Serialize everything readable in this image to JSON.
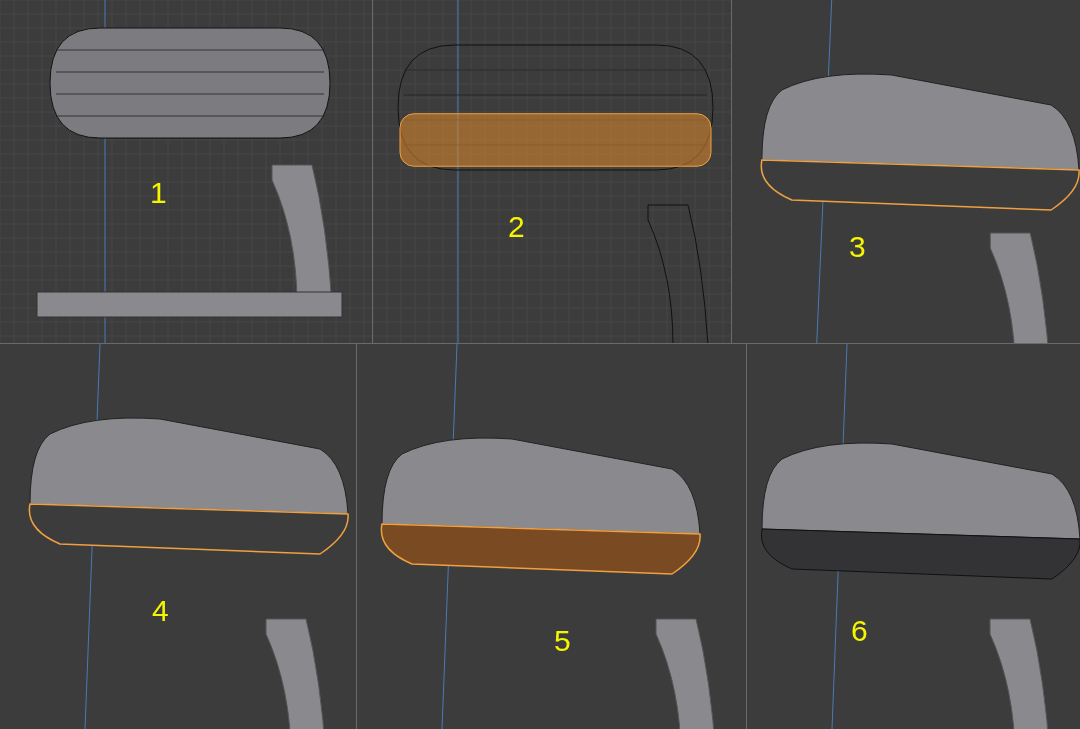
{
  "panels": [
    {
      "label": "1",
      "kind": "ortho",
      "wireframe": false,
      "lower_half_selected": false,
      "bottom_loop_selected": false,
      "bottom_face_selected": false
    },
    {
      "label": "2",
      "kind": "ortho",
      "wireframe": true,
      "lower_half_selected": true,
      "bottom_loop_selected": false,
      "bottom_face_selected": false
    },
    {
      "label": "3",
      "kind": "persp",
      "wireframe": false,
      "lower_half_selected": false,
      "bottom_loop_selected": true,
      "bottom_face_selected": false
    },
    {
      "label": "4",
      "kind": "persp",
      "wireframe": false,
      "lower_half_selected": false,
      "bottom_loop_selected": true,
      "bottom_face_selected": false
    },
    {
      "label": "5",
      "kind": "persp",
      "wireframe": false,
      "lower_half_selected": false,
      "bottom_loop_selected": true,
      "bottom_face_selected": true
    },
    {
      "label": "6",
      "kind": "persp",
      "wireframe": false,
      "lower_half_selected": false,
      "bottom_loop_selected": false,
      "bottom_face_selected": false
    }
  ]
}
